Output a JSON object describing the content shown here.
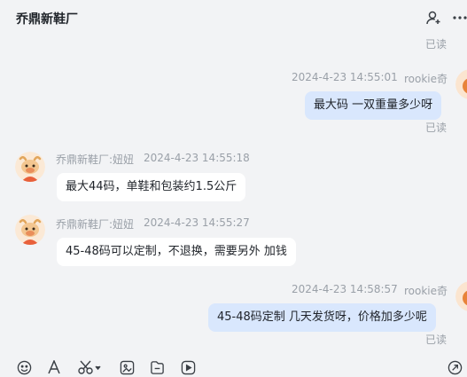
{
  "header": {
    "title": "乔鼎新鞋厂",
    "icons": [
      "user-plus-icon",
      "more-icon"
    ]
  },
  "messages": [
    {
      "direction": "out",
      "read": "已读"
    },
    {
      "direction": "out",
      "sender": "rookie奇",
      "time": "2024-4-23 14:55:01",
      "text": "最大码  一双重量多少呀",
      "read": "已读"
    },
    {
      "direction": "in",
      "sender": "乔鼎新鞋厂:妞妞",
      "time": "2024-4-23 14:55:18",
      "text": "最大44码，单鞋和包装约1.5公斤"
    },
    {
      "direction": "in",
      "sender": "乔鼎新鞋厂:妞妞",
      "time": "2024-4-23 14:55:27",
      "text": "45-48码可以定制，不退换，需要另外 加钱"
    },
    {
      "direction": "out",
      "sender": "rookie奇",
      "time": "2024-4-23 14:58:57",
      "text": "45-48码定制  几天发货呀，价格加多少呢",
      "read": "已读"
    }
  ],
  "toolbar": {
    "icons": [
      "emoji-icon",
      "font-icon",
      "scissors-icon",
      "screenshot-icon",
      "file-icon",
      "video-icon",
      "history-icon"
    ]
  },
  "colors": {
    "out_bubble": "#d9e7fd",
    "in_bubble": "#ffffff",
    "bg": "#f2f3f5",
    "meta": "#9aa0a8"
  }
}
